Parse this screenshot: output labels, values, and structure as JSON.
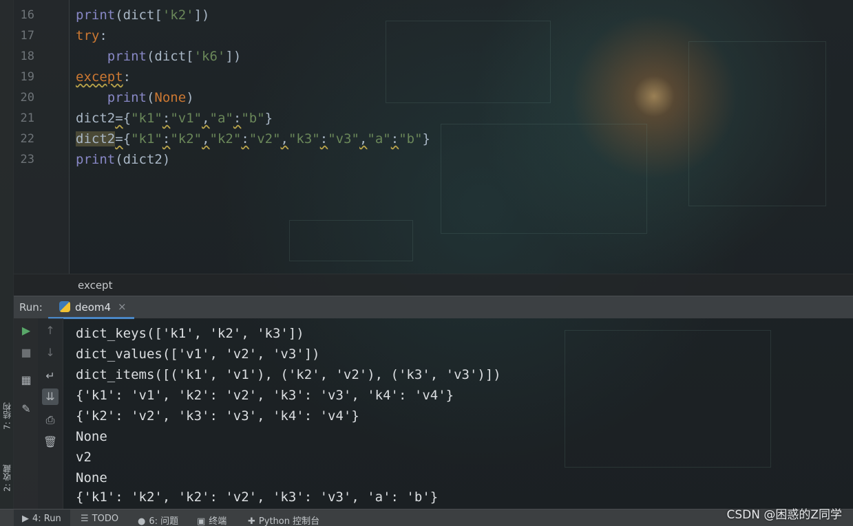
{
  "editor": {
    "line_numbers": [
      "16",
      "17",
      "18",
      "19",
      "20",
      "21",
      "22",
      "23"
    ],
    "breadcrumb": "except"
  },
  "run_panel": {
    "label": "Run:",
    "tab_label": "deom4",
    "close_glyph": "×",
    "output_lines": [
      "dict_keys(['k1', 'k2', 'k3'])",
      "dict_values(['v1', 'v2', 'v3'])",
      "dict_items([('k1', 'v1'), ('k2', 'v2'), ('k3', 'v3')])",
      "{'k1': 'v1', 'k2': 'v2', 'k3': 'v3', 'k4': 'v4'}",
      "{'k2': 'v2', 'k3': 'v3', 'k4': 'v4'}",
      "None",
      "v2",
      "None",
      "{'k1': 'k2', 'k2': 'v2', 'k3': 'v3', 'a': 'b'}"
    ]
  },
  "side_tabs": {
    "structure": "7: 结构",
    "favorites": "2: 收藏"
  },
  "status_bar": {
    "run": "4: Run",
    "todo": "TODO",
    "problems": "6: 问题",
    "terminal": "终端",
    "python_console": "Python 控制台"
  },
  "watermark": "CSDN @困惑的Z同学",
  "colors": {
    "keyword": "#cc7832",
    "builtin": "#8888c6",
    "string": "#6a8759",
    "accent": "#4a88c7"
  }
}
